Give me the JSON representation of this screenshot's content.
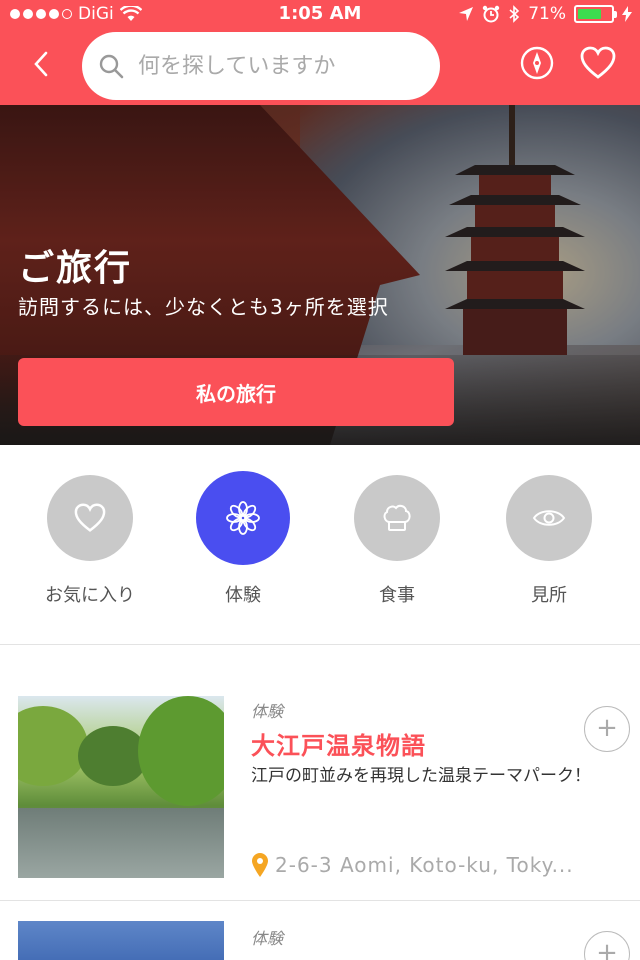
{
  "status_bar": {
    "carrier": "DiGi",
    "time": "1:05 AM",
    "battery": "71%",
    "battery_level": 0.71,
    "battery_color": "#3ddc4f"
  },
  "header": {
    "search_placeholder": "何を探していますか",
    "accent_color": "#fb5158"
  },
  "hero": {
    "title": "ご旅行",
    "subtitle": "訪問するには、少なくとも3ヶ所を選択",
    "button_label": "私の旅行"
  },
  "categories": [
    {
      "label": "お気に入り",
      "icon": "heart-icon",
      "active": false
    },
    {
      "label": "体験",
      "icon": "flower-icon",
      "active": true
    },
    {
      "label": "食事",
      "icon": "chef-hat-icon",
      "active": false
    },
    {
      "label": "見所",
      "icon": "eye-icon",
      "active": false
    }
  ],
  "active_category_color": "#4a4ef0",
  "items": [
    {
      "category": "体験",
      "title": "大江戸温泉物語",
      "description": "江戸の町並みを再現した温泉テーマパーク！",
      "location": "2-6-3 Aomi, Koto-ku, Toky..."
    },
    {
      "category": "体験",
      "title": "",
      "description": "",
      "location": ""
    }
  ]
}
